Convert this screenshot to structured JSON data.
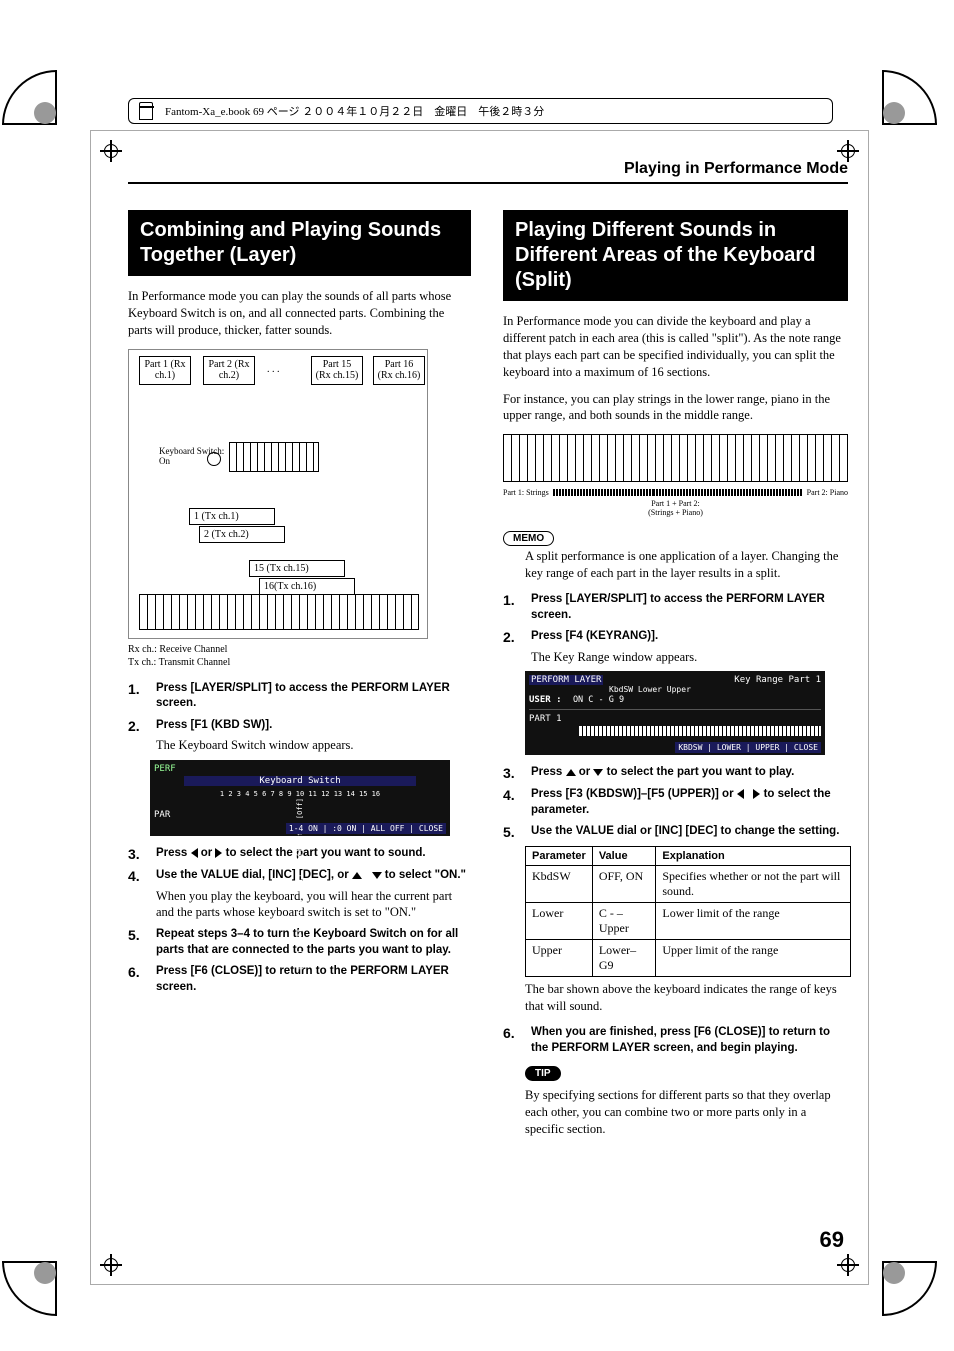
{
  "booktop": "Fantom-Xa_e.book 69 ページ ２００４年１０月２２日　金曜日　午後２時３分",
  "header": "Playing in Performance Mode",
  "page_number": "69",
  "left": {
    "title": "Combining and Playing Sounds Together (Layer)",
    "intro": "In Performance mode you can play the sounds of all parts whose Keyboard Switch is on, and all connected parts. Combining the parts will produce, thicker, fatter sounds.",
    "diagram": {
      "part1": "Part 1\n(Rx ch.1)",
      "part2": "Part 2\n(Rx ch.2)",
      "dots": ". . .",
      "part15": "Part 15\n(Rx ch.15)",
      "part16": "Part 16\n(Rx ch.16)",
      "kbdsw": "Keyboard Switch:\nOn",
      "tx1": "1 (Tx ch.1)",
      "tx2": "2 (Tx ch.2)",
      "tx15": "15 (Tx ch.15)",
      "tx16": "16(Tx ch.16)"
    },
    "ch_labels": {
      "rx": "Rx ch.: Receive Channel",
      "tx": "Tx ch.: Transmit Channel"
    },
    "steps": [
      {
        "n": "1.",
        "b": "Press [LAYER/SPLIT] to access the PERFORM LAYER screen."
      },
      {
        "n": "2.",
        "b": "Press [F1 (KBD SW)].",
        "body": "The Keyboard Switch window appears."
      },
      {
        "n": "3.",
        "b_pre": "Press ",
        "b_post": " to select the part you want to sound.",
        "arrows": "lr_or"
      },
      {
        "n": "4.",
        "b_pre": "Use the VALUE dial, [INC] [DEC], or ",
        "b_post": " to select \"ON.\"",
        "arrows": "ud",
        "body": "When you play the keyboard, you will hear the current part and the parts whose keyboard switch is set to \"ON.\""
      },
      {
        "n": "5.",
        "b": "Repeat steps 3–4 to turn the Keyboard Switch on for all parts that are connected to the parts you want to play."
      },
      {
        "n": "6.",
        "b": "Press [F6 (CLOSE)] to return to the PERFORM LAYER screen."
      }
    ],
    "screenshot": {
      "title": "Keyboard Switch",
      "buttons": "1-4 ON | :0 ON | ALL OFF | CLOSE",
      "corner": "PERF",
      "part": "PAR"
    }
  },
  "right": {
    "title": "Playing Different Sounds in Different Areas of the Keyboard (Split)",
    "intro1": "In Performance mode you can divide the keyboard and play a different patch in each area (this is called \"split\"). As the note range that plays each part can be specified individually, you can split the keyboard into a maximum of 16 sections.",
    "intro2": "For instance, you can play strings in the lower range, piano in the upper range, and both sounds in the middle range.",
    "split_legend": {
      "p1": "Part 1: Strings",
      "mid": "Part 1 + Part 2:\n(Strings + Piano)",
      "p2": "Part 2: Piano"
    },
    "memo": "MEMO",
    "memo_body": "A split performance is one application of a layer. Changing the key range of each part in the layer results in a split.",
    "steps": [
      {
        "n": "1.",
        "b": "Press [LAYER/SPLIT] to access the PERFORM LAYER screen."
      },
      {
        "n": "2.",
        "b": "Press [F4 (KEYRANG)].",
        "body": "The Key Range window appears."
      },
      {
        "n": "3.",
        "b_pre": "Press ",
        "b_post": " to select the part you want to play.",
        "arrows": "ud_or"
      },
      {
        "n": "4.",
        "b_pre": "Press [F3 (KBDSW)]–[F5 (UPPER)] or ",
        "b_post": " to select the parameter.",
        "arrows": "lr"
      },
      {
        "n": "5.",
        "b": "Use the VALUE dial or [INC] [DEC] to change the setting."
      }
    ],
    "screenshot": {
      "title": "PERFORM LAYER",
      "sub": "Key Range Part 1",
      "row": "KbdSW    Lower    Upper",
      "user": "USER :",
      "vals": "ON   C -    G 9",
      "part": "PART  1",
      "buttons": "KBDSW | LOWER | UPPER | CLOSE"
    },
    "table": {
      "headers": [
        "Parameter",
        "Value",
        "Explanation"
      ],
      "rows": [
        [
          "KbdSW",
          "OFF, ON",
          "Specifies whether or not the part will sound."
        ],
        [
          "Lower",
          "C - –Upper",
          "Lower limit of the range"
        ],
        [
          "Upper",
          "Lower–G9",
          "Upper limit of the range"
        ]
      ]
    },
    "after_table": "The bar shown above the keyboard indicates the range of keys that will sound.",
    "step6": {
      "n": "6.",
      "b": "When you are finished, press [F6 (CLOSE)] to return to the PERFORM LAYER screen, and begin playing."
    },
    "tip": "TIP",
    "tip_body": "By specifying sections for different parts so that they overlap each other, you can combine two or more parts only in a specific section."
  }
}
